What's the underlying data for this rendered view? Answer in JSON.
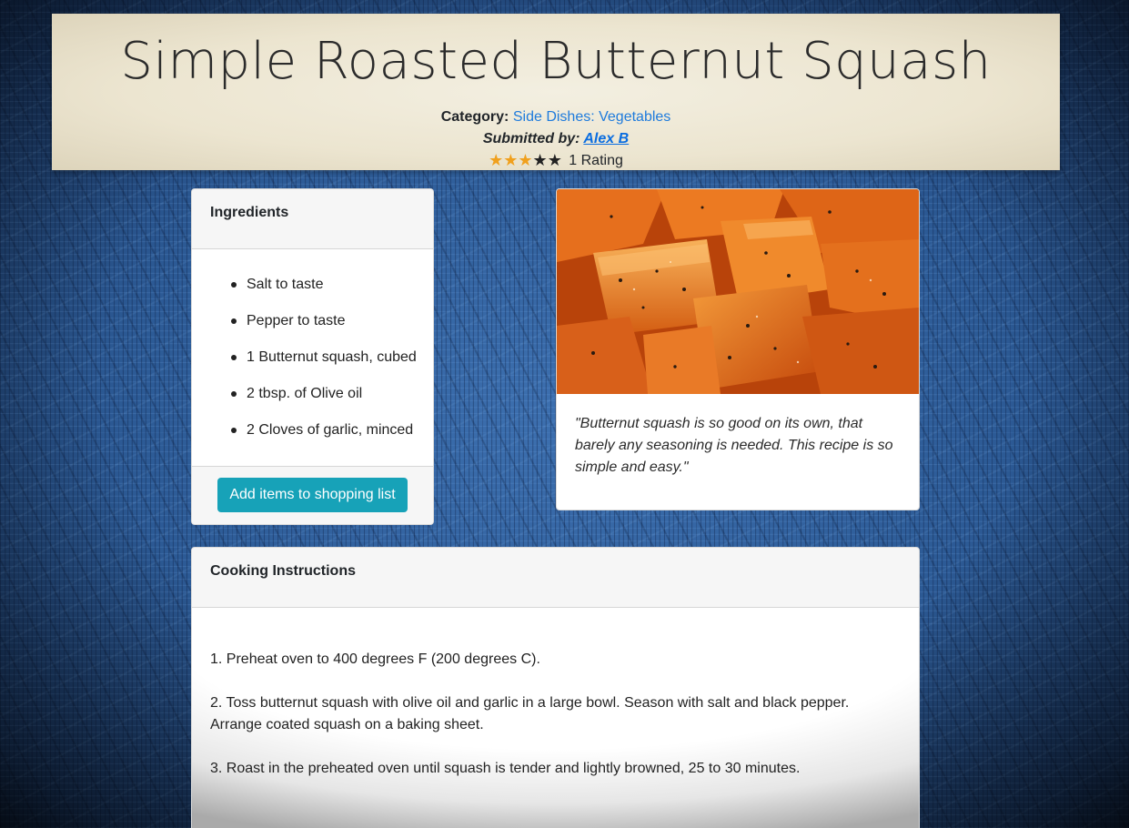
{
  "recipe": {
    "title": "Simple Roasted Butternut Squash",
    "category_label": "Category:",
    "category_value": "Side Dishes: Vegetables",
    "submitted_label": "Submitted by:",
    "submitted_by": "Alex B",
    "rating_value": 3,
    "rating_max": 5,
    "rating_text": "1 Rating"
  },
  "ingredients": {
    "header": "Ingredients",
    "items": [
      "Salt to taste",
      "Pepper to taste",
      "1 Butternut squash, cubed",
      "2 tbsp. of Olive oil",
      "2 Cloves of garlic, minced"
    ],
    "button_label": "Add items to shopping list"
  },
  "photo": {
    "quote": "\"Butternut squash is so good on its own, that barely any seasoning is needed. This recipe is so simple and easy.\""
  },
  "instructions": {
    "header": "Cooking Instructions",
    "steps": [
      "1. Preheat oven to 400 degrees F (200 degrees C).",
      "2. Toss butternut squash with olive oil and garlic in a large bowl. Season with salt and black pepper. Arrange coated squash on a baking sheet.",
      "3. Roast in the preheated oven until squash is tender and lightly browned, 25 to 30 minutes."
    ]
  },
  "icons": {
    "star": "star-icon"
  },
  "colors": {
    "accent_link": "#1e7bdc",
    "star_filled": "#f0a01d",
    "star_empty": "#222222",
    "button": "#17a2b8"
  }
}
